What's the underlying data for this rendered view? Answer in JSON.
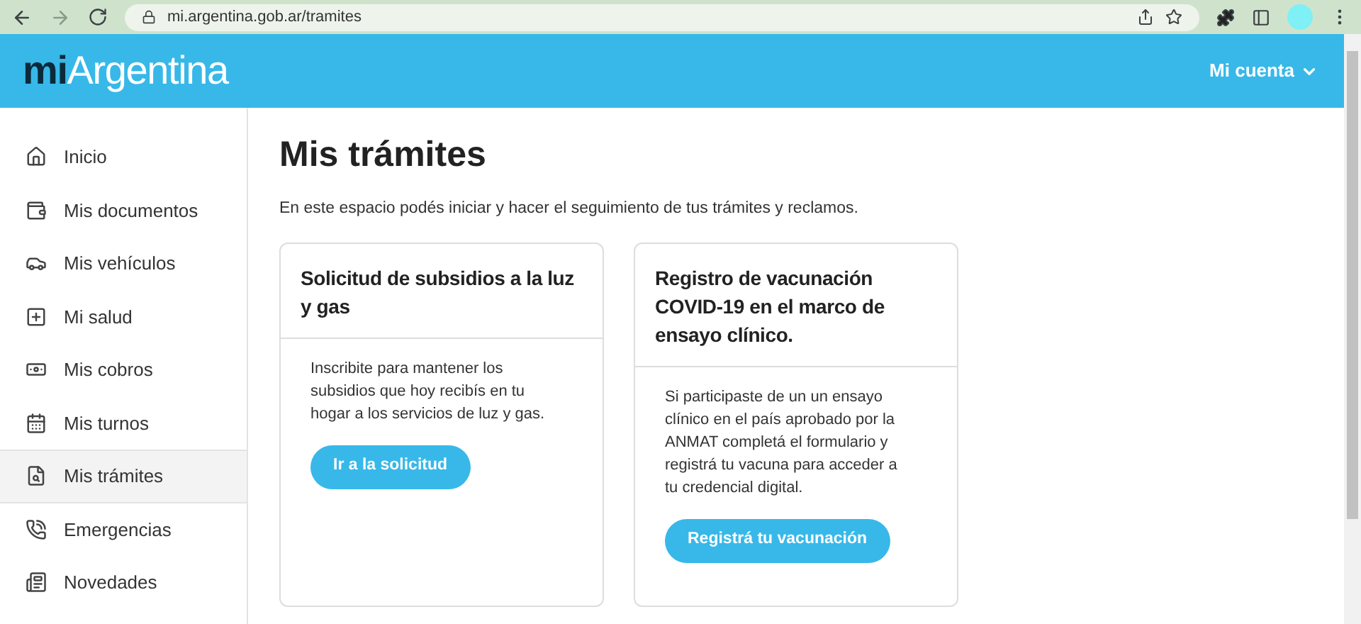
{
  "browser": {
    "url": "mi.argentina.gob.ar/tramites"
  },
  "header": {
    "logo_prefix": "mi",
    "logo_name": "Argentina",
    "account_menu": "Mi cuenta"
  },
  "sidebar": {
    "items": [
      {
        "label": "Inicio",
        "selected": false
      },
      {
        "label": "Mis documentos",
        "selected": false
      },
      {
        "label": "Mis vehículos",
        "selected": false
      },
      {
        "label": "Mi salud",
        "selected": false
      },
      {
        "label": "Mis cobros",
        "selected": false
      },
      {
        "label": "Mis turnos",
        "selected": false
      },
      {
        "label": "Mis trámites",
        "selected": true
      },
      {
        "label": "Emergencias",
        "selected": false
      },
      {
        "label": "Novedades",
        "selected": false
      }
    ]
  },
  "page": {
    "title": "Mis trámites",
    "intro": "En este espacio podés iniciar y hacer el seguimiento de tus trámites y reclamos.",
    "cards": [
      {
        "title": "Solicitud de subsidios a la luz y gas",
        "text": "Inscribite para mantener los subsidios que hoy recibís en tu hogar a los servicios de luz y gas.",
        "button": "Ir a la solicitud"
      },
      {
        "title": "Registro de vacunación COVID-19 en el marco de ensayo clínico.",
        "text": "Si participaste de un un ensayo clínico en el país aprobado por la ANMAT completá el formulario y registrá tu vacuna para acceder a tu credencial digital.",
        "button": "Registrá tu vacunación"
      }
    ]
  }
}
